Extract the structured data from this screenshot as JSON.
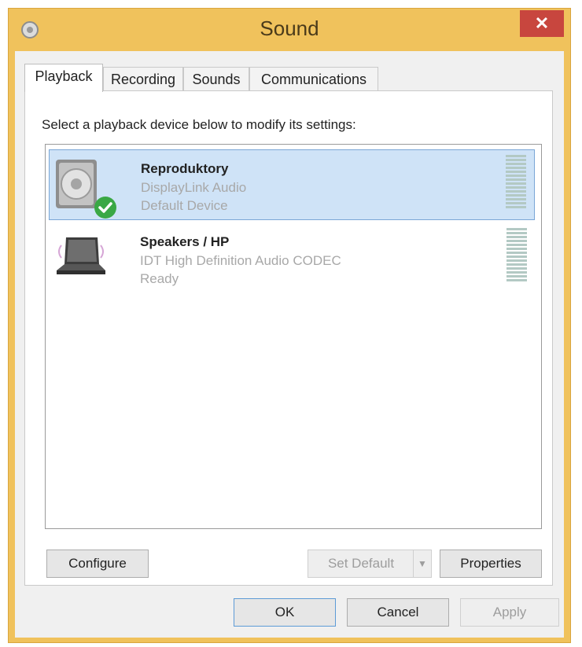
{
  "window": {
    "title": "Sound",
    "close_label": "✕",
    "accent_color": "#f0c25c"
  },
  "tabs": [
    {
      "label": "Playback",
      "active": true
    },
    {
      "label": "Recording",
      "active": false
    },
    {
      "label": "Sounds",
      "active": false
    },
    {
      "label": "Communications",
      "active": false
    }
  ],
  "playback": {
    "instruction": "Select a playback device below to modify its settings:",
    "devices": [
      {
        "name": "Reproduktory",
        "driver": "DisplayLink Audio",
        "status": "Default Device",
        "icon": "speaker-icon",
        "selected": true,
        "default_badge": "check-icon"
      },
      {
        "name": "Speakers / HP",
        "driver": "IDT High Definition Audio CODEC",
        "status": "Ready",
        "icon": "laptop-speaker-icon",
        "selected": false
      }
    ]
  },
  "panel_buttons": {
    "configure": "Configure",
    "set_default": "Set Default",
    "properties": "Properties"
  },
  "dialog_buttons": {
    "ok": "OK",
    "cancel": "Cancel",
    "apply": "Apply"
  }
}
